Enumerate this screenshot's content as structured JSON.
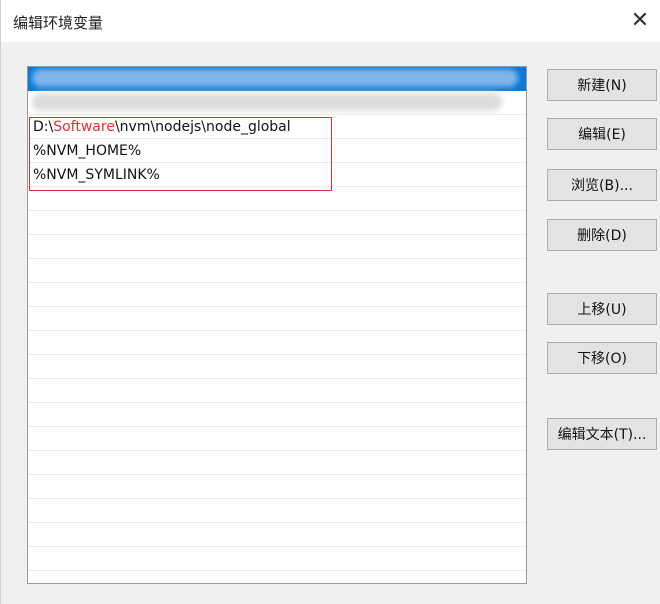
{
  "window": {
    "title": "编辑环境变量",
    "close_glyph": "✕"
  },
  "list": {
    "rows": [
      {
        "text": "",
        "selected": true,
        "obscured": true
      },
      {
        "text": "",
        "selected": false,
        "obscured": true
      },
      {
        "text_parts": [
          "D:\\",
          "Software",
          "\\nvm\\nodejs\\node_global"
        ],
        "highlight_index": 1
      },
      {
        "text": "%NVM_HOME%"
      },
      {
        "text": "%NVM_SYMLINK%"
      }
    ],
    "selected_color": "#0a78d7",
    "annotation_color": "#e03030"
  },
  "buttons": {
    "new": "新建(N)",
    "edit": "编辑(E)",
    "browse": "浏览(B)...",
    "delete": "删除(D)",
    "move_up": "上移(U)",
    "move_down": "下移(O)",
    "edit_text": "编辑文本(T)..."
  },
  "icons": {
    "close": "close-icon"
  }
}
